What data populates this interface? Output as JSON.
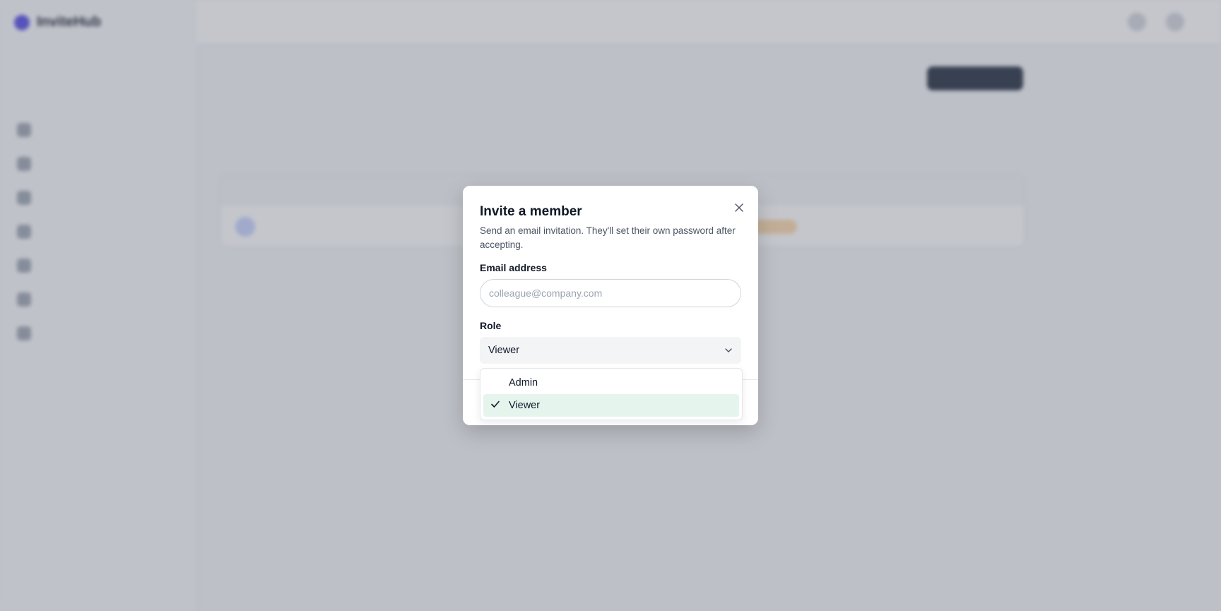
{
  "app": {
    "name": "InviteHub"
  },
  "modal": {
    "title": "Invite a member",
    "description": "Send an email invitation. They'll set their own password after accepting.",
    "close_icon": "close-icon",
    "email": {
      "label": "Email address",
      "placeholder": "colleague@company.com",
      "value": ""
    },
    "role": {
      "label": "Role",
      "selected": "Viewer",
      "options": [
        {
          "label": "Admin",
          "selected": false
        },
        {
          "label": "Viewer",
          "selected": true
        }
      ]
    }
  },
  "colors": {
    "primary": "#1e293b",
    "selected_option": "#e6f4ee",
    "overlay": "rgba(100,106,120,0.38)"
  }
}
